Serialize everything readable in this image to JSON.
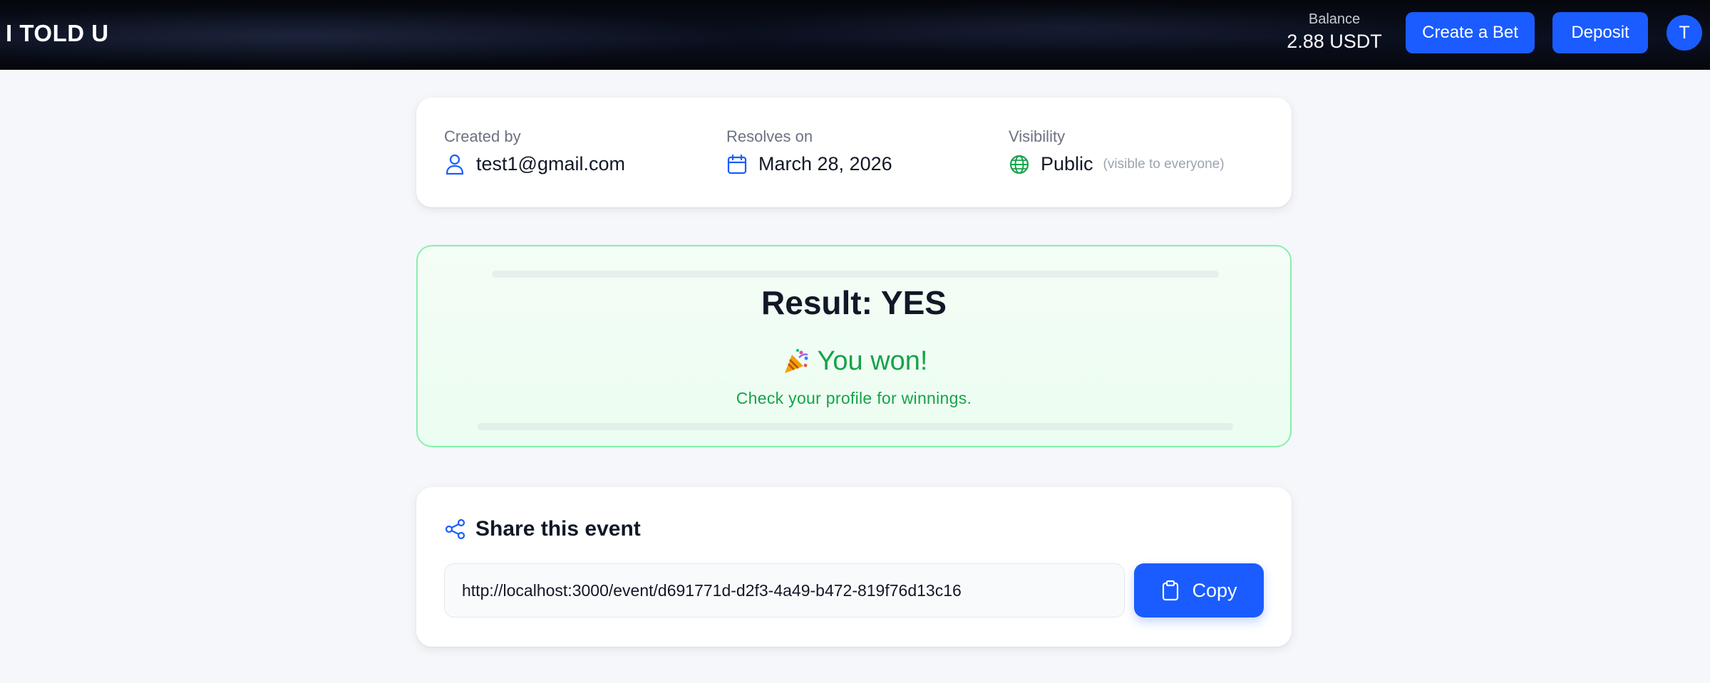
{
  "header": {
    "brand": "I TOLD U",
    "balance_label": "Balance",
    "balance_value": "2.88 USDT",
    "create_bet_label": "Create a Bet",
    "deposit_label": "Deposit",
    "avatar_initial": "T"
  },
  "info": {
    "created_by_label": "Created by",
    "created_by_value": "test1@gmail.com",
    "resolves_label": "Resolves on",
    "resolves_value": "March 28, 2026",
    "visibility_label": "Visibility",
    "visibility_value": "Public",
    "visibility_note": "(visible to everyone)"
  },
  "result": {
    "title": "Result: YES",
    "won_text": "You won!",
    "subtext": "Check your profile for winnings."
  },
  "share": {
    "title": "Share this event",
    "url": "http://localhost:3000/event/d691771d-d2f3-4a49-b472-819f76d13c16",
    "copy_label": "Copy"
  },
  "colors": {
    "accent": "#1a5cff",
    "success": "#16a34a",
    "success_border": "#86efac"
  },
  "icons": {
    "creator": "user-icon",
    "date": "calendar-icon",
    "visibility": "globe-icon",
    "result": "party-popper-icon",
    "share": "share-icon",
    "copy": "clipboard-icon"
  }
}
